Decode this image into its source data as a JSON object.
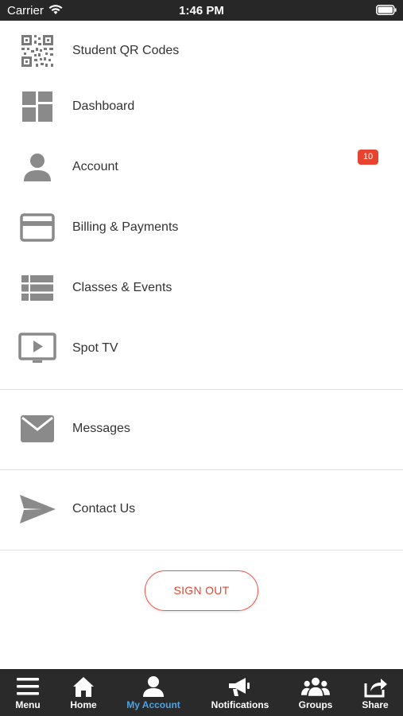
{
  "status_bar": {
    "carrier": "Carrier",
    "time": "1:46 PM"
  },
  "menu": {
    "items": [
      {
        "label": "Student QR Codes",
        "icon": "qr-code-icon"
      },
      {
        "label": "Dashboard",
        "icon": "dashboard-icon"
      },
      {
        "label": "Account",
        "icon": "person-icon",
        "badge": "10"
      },
      {
        "label": "Billing & Payments",
        "icon": "credit-card-icon"
      },
      {
        "label": "Classes & Events",
        "icon": "list-icon"
      },
      {
        "label": "Spot TV",
        "icon": "tv-play-icon"
      },
      {
        "label": "Messages",
        "icon": "envelope-icon"
      },
      {
        "label": "Contact Us",
        "icon": "send-icon"
      }
    ]
  },
  "sign_out_label": "SIGN OUT",
  "tab_bar": {
    "tabs": [
      {
        "label": "Menu",
        "icon": "hamburger-icon"
      },
      {
        "label": "Home",
        "icon": "home-icon"
      },
      {
        "label": "My Account",
        "icon": "account-icon",
        "active": true
      },
      {
        "label": "Notifications",
        "icon": "megaphone-icon"
      },
      {
        "label": "Groups",
        "icon": "groups-icon"
      },
      {
        "label": "Share",
        "icon": "share-icon"
      }
    ]
  },
  "colors": {
    "accent_red": "#e8432e",
    "active_tab": "#4aa3e4",
    "tab_bar_bg": "#2a2a2a",
    "icon_gray": "#8a8a8a"
  }
}
